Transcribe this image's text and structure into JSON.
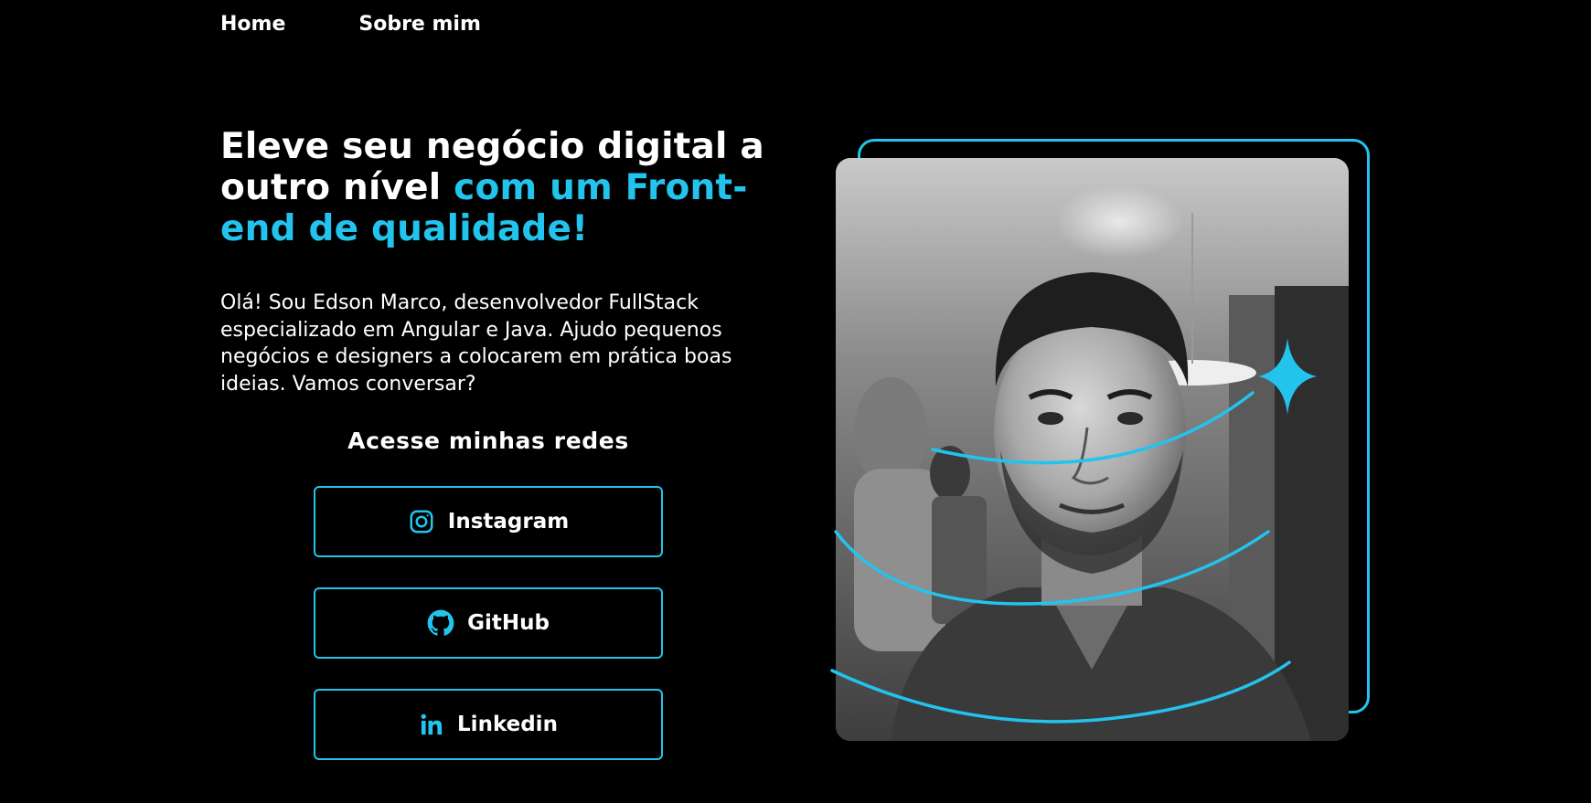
{
  "nav": {
    "home": "Home",
    "about": "Sobre mim"
  },
  "hero": {
    "headline_part1": "Eleve seu negócio digital a outro nível",
    "headline_part2": "com um Front-end de qualidade!",
    "intro": "Olá! Sou Edson Marco, desenvolvedor FullStack especializado em Angular e Java. Ajudo pequenos negócios e designers a colocarem em prática boas ideias. Vamos conversar?"
  },
  "social": {
    "title": "Acesse minhas redes",
    "instagram": "Instagram",
    "github": "GitHub",
    "linkedin": "Linkedin"
  },
  "colors": {
    "accent": "#22c4ee",
    "background": "#000000",
    "text": "#ffffff"
  },
  "icons": [
    "instagram-icon",
    "github-icon",
    "linkedin-icon",
    "sparkle-icon"
  ]
}
